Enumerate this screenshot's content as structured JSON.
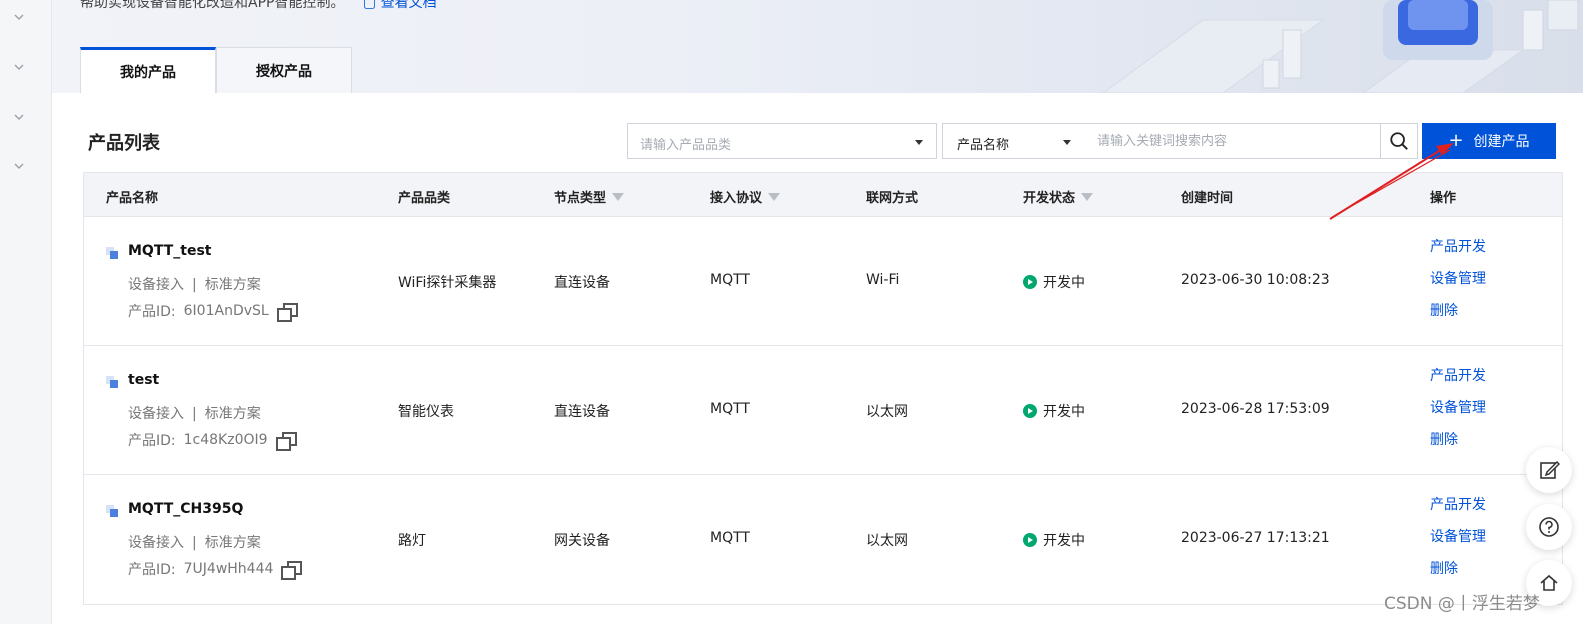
{
  "banner": {
    "intro_text": "帮助实现设备智能化改造和APP智能控制。",
    "doc_link": "查看文档"
  },
  "tabs": [
    {
      "label": "我的产品",
      "active": true
    },
    {
      "label": "授权产品",
      "active": false
    }
  ],
  "toolbar": {
    "title": "产品列表",
    "category_placeholder": "请输入产品品类",
    "search_field": "产品名称",
    "search_placeholder": "请输入关键词搜索内容",
    "create_label": "创建产品"
  },
  "table": {
    "columns": [
      "产品名称",
      "产品品类",
      "节点类型",
      "接入协议",
      "联网方式",
      "开发状态",
      "创建时间",
      "操作"
    ],
    "rows": [
      {
        "name": "MQTT_test",
        "access": "设备接入",
        "scheme": "标准方案",
        "pid_label": "产品ID:",
        "pid": "6I01AnDvSL",
        "category": "WiFi探针采集器",
        "node_type": "直连设备",
        "protocol": "MQTT",
        "network": "Wi-Fi",
        "status": "开发中",
        "created": "2023-06-30 10:08:23",
        "ops": [
          "产品开发",
          "设备管理",
          "删除"
        ]
      },
      {
        "name": "test",
        "access": "设备接入",
        "scheme": "标准方案",
        "pid_label": "产品ID:",
        "pid": "1c48Kz0OI9",
        "category": "智能仪表",
        "node_type": "直连设备",
        "protocol": "MQTT",
        "network": "以太网",
        "status": "开发中",
        "created": "2023-06-28 17:53:09",
        "ops": [
          "产品开发",
          "设备管理",
          "删除"
        ]
      },
      {
        "name": "MQTT_CH395Q",
        "access": "设备接入",
        "scheme": "标准方案",
        "pid_label": "产品ID:",
        "pid": "7UJ4wHh444",
        "category": "路灯",
        "node_type": "网关设备",
        "protocol": "MQTT",
        "network": "以太网",
        "status": "开发中",
        "created": "2023-06-27 17:13:21",
        "ops": [
          "产品开发",
          "设备管理",
          "删除"
        ]
      }
    ]
  },
  "float_buttons": [
    "edit-icon",
    "help-icon",
    "home-icon"
  ],
  "watermark": "CSDN @丨浮生若梦",
  "colors": {
    "primary": "#0052d9",
    "status_green": "#00a870",
    "annotation_red": "#e02020"
  }
}
